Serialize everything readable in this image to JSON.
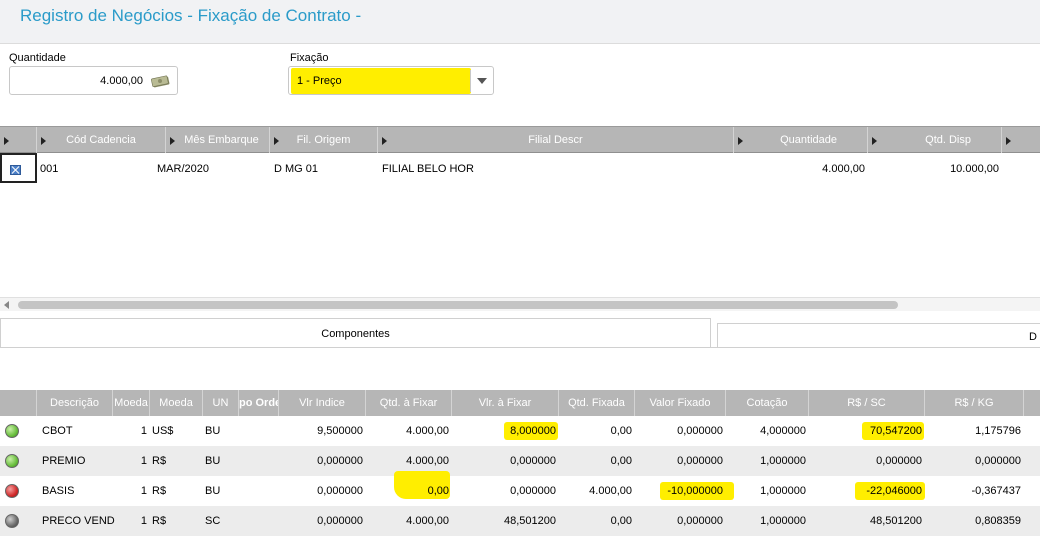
{
  "title": "Registro de Negócios - Fixação de Contrato -",
  "quantidade": {
    "label": "Quantidade",
    "value": "4.000,00"
  },
  "fixacao": {
    "label": "Fixação",
    "value": "1 - Preço"
  },
  "cadencias": {
    "columns": [
      "Cód Cadencia",
      "Mês Embarque",
      "Fil. Origem",
      "Filial Descr",
      "Quantidade",
      "Qtd. Disp"
    ],
    "rows": [
      {
        "cod": "001",
        "mes": "MAR/2020",
        "fil": "D MG 01",
        "descr": "FILIAL BELO HOR",
        "qtd": "4.000,00",
        "disp": "10.000,00"
      }
    ]
  },
  "tabs": {
    "componentes": "Componentes",
    "second": "D"
  },
  "componentes": {
    "columns": [
      "Descrição",
      "Moeda",
      "Moeda",
      "UN",
      "po Orde",
      "Vlr Indice",
      "Qtd. à Fixar",
      "Vlr. à Fixar",
      "Qtd. Fixada",
      "Valor Fixado",
      "Cotação",
      "R$ / SC",
      "R$ / KG"
    ],
    "rows": [
      {
        "status": "green",
        "descricao": "CBOT",
        "moeda_num": "1",
        "moeda": "US$",
        "un": "BU",
        "vlr_indice": "9,500000",
        "qtd_fixar": "4.000,00",
        "vlr_fixar": "8,000000",
        "qtd_fixada": "0,00",
        "valor_fixado": "0,000000",
        "cotacao": "4,000000",
        "rs_sc": "70,547200",
        "rs_kg": "1,175796"
      },
      {
        "status": "green",
        "descricao": "PREMIO",
        "moeda_num": "1",
        "moeda": "R$",
        "un": "BU",
        "vlr_indice": "0,000000",
        "qtd_fixar": "4.000,00",
        "vlr_fixar": "0,000000",
        "qtd_fixada": "0,00",
        "valor_fixado": "0,000000",
        "cotacao": "1,000000",
        "rs_sc": "0,000000",
        "rs_kg": "0,000000"
      },
      {
        "status": "red",
        "descricao": "BASIS",
        "moeda_num": "1",
        "moeda": "R$",
        "un": "BU",
        "vlr_indice": "0,000000",
        "qtd_fixar": "0,00",
        "vlr_fixar": "0,000000",
        "qtd_fixada": "4.000,00",
        "valor_fixado": "-10,000000",
        "cotacao": "1,000000",
        "rs_sc": "-22,046000",
        "rs_kg": "-0,367437"
      },
      {
        "status": "gray",
        "descricao": "PRECO VEND",
        "moeda_num": "1",
        "moeda": "R$",
        "un": "SC",
        "vlr_indice": "0,000000",
        "qtd_fixar": "4.000,00",
        "vlr_fixar": "48,501200",
        "qtd_fixada": "0,00",
        "valor_fixado": "0,000000",
        "cotacao": "1,000000",
        "rs_sc": "48,501200",
        "rs_kg": "0,808359"
      }
    ]
  },
  "colors": {
    "accent": "#2a9bc9",
    "highlight": "#ffee00",
    "header": "#b6b6b6",
    "status_green": "#6abf3e",
    "status_red": "#d22b2b",
    "status_gray": "#6e6e6e"
  }
}
